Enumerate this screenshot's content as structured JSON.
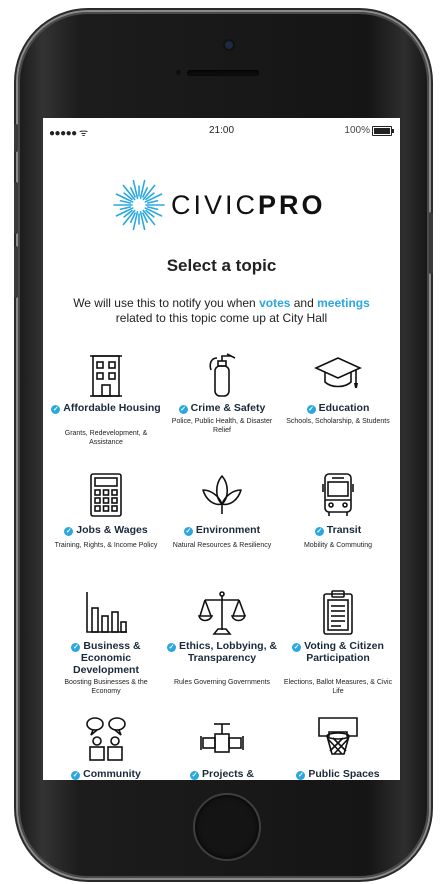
{
  "status_bar": {
    "signal": "●●●●●",
    "wifi": "ᯤ",
    "time": "21:00",
    "battery": "100%"
  },
  "brand": {
    "name_regular": "CIVIC",
    "name_bold": "PRO",
    "accent": "#29a8e0"
  },
  "page": {
    "heading": "Select a topic",
    "intro_1": "We will use this to notify you when ",
    "intro_votes": "votes",
    "intro_and": " and ",
    "intro_meetings": "meetings",
    "intro_2": " related to this topic come up at City Hall"
  },
  "topics": [
    {
      "title": "Affordable Housing",
      "desc": "Grants, Redevelopment, & Assistance",
      "icon": "building-icon"
    },
    {
      "title": "Crime & Safety",
      "desc": "Police, Public Health, & Disaster Relief",
      "icon": "fire-extinguisher-icon"
    },
    {
      "title": "Education",
      "desc": "Schools, Scholarship, & Students",
      "icon": "graduation-cap-icon"
    },
    {
      "title": "Jobs & Wages",
      "desc": "Training, Rights, & Income Policy",
      "icon": "calculator-icon"
    },
    {
      "title": "Environment",
      "desc": "Natural Resources & Resiliency",
      "icon": "leaf-icon"
    },
    {
      "title": "Transit",
      "desc": "Mobility & Commuting",
      "icon": "bus-icon"
    },
    {
      "title": "Business & Economic Development",
      "desc": "Boosting Businesses & the Economy",
      "icon": "bar-chart-icon"
    },
    {
      "title": "Ethics, Lobbying, & Transparency",
      "desc": "Rules Governing Governments",
      "icon": "scales-icon"
    },
    {
      "title": "Voting & Citizen Participation",
      "desc": "Elections, Ballot Measures, & Civic Life",
      "icon": "clipboard-icon"
    },
    {
      "title": "Community",
      "desc": "",
      "icon": "people-speech-icon"
    },
    {
      "title": "Projects &",
      "desc": "",
      "icon": "pipe-valve-icon"
    },
    {
      "title": "Public Spaces",
      "desc": "",
      "icon": "basketball-hoop-icon"
    }
  ]
}
